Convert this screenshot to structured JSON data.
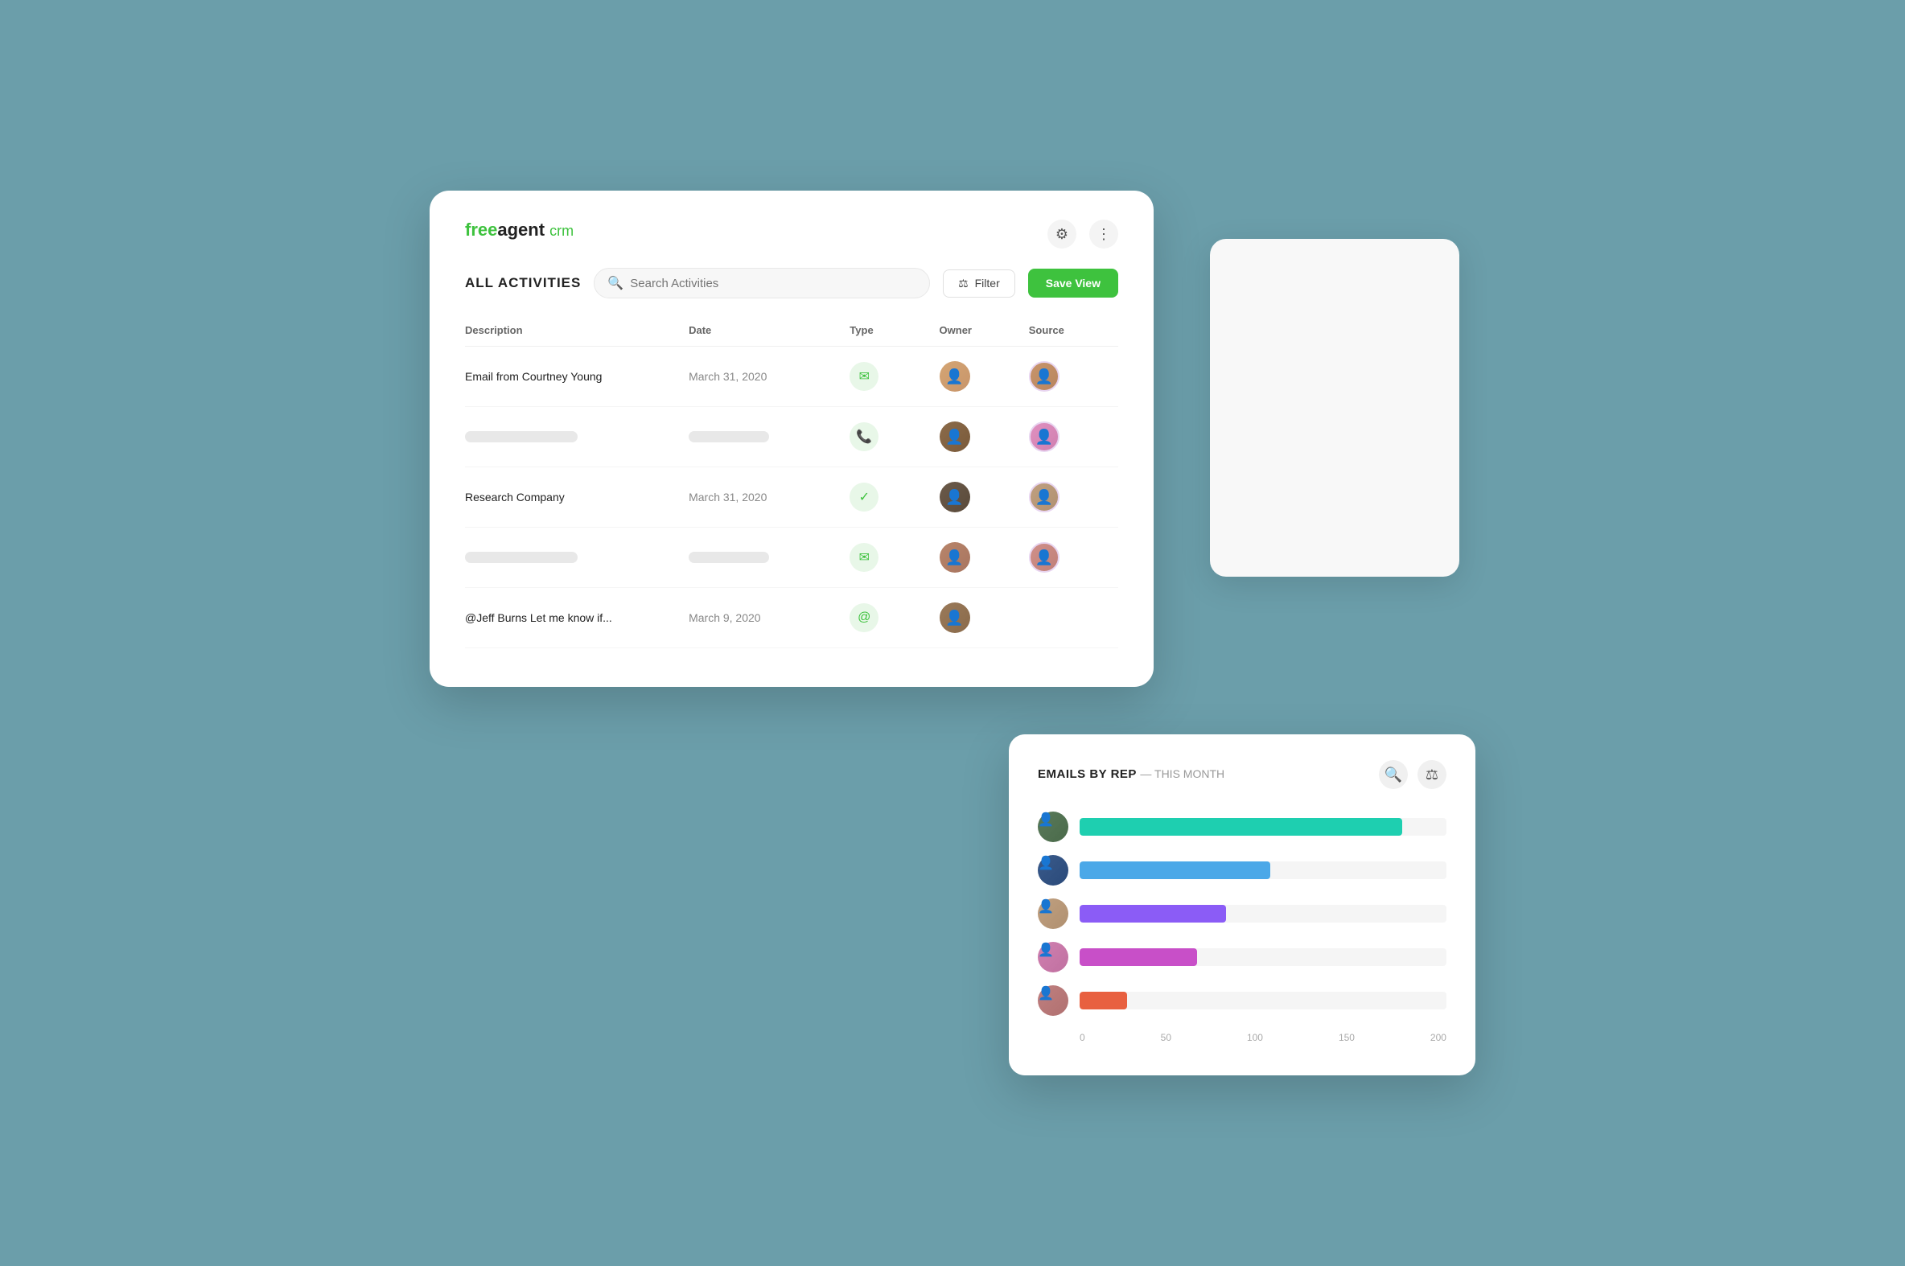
{
  "logo": {
    "free": "free",
    "agent": "agent",
    "crm": "crm"
  },
  "header": {
    "title": "ALL ACTIVITIES",
    "search_placeholder": "Search Activities",
    "filter_label": "Filter",
    "save_view_label": "Save View"
  },
  "table": {
    "columns": [
      "Description",
      "Date",
      "Type",
      "Owner",
      "Source"
    ],
    "rows": [
      {
        "description": "Email from Courtney Young",
        "date": "March 31, 2020",
        "type": "email",
        "type_icon": "✉",
        "owner_avatar": "av-a1",
        "source_avatar": "av-s1",
        "skeleton": false
      },
      {
        "description": "",
        "date": "",
        "type": "phone",
        "type_icon": "✆",
        "owner_avatar": "av-a2",
        "source_avatar": "av-s2",
        "skeleton": true
      },
      {
        "description": "Research Company",
        "date": "March 31, 2020",
        "type": "check",
        "type_icon": "✓",
        "owner_avatar": "av-a3",
        "source_avatar": "av-s3",
        "skeleton": false
      },
      {
        "description": "",
        "date": "",
        "type": "email",
        "type_icon": "✉",
        "owner_avatar": "av-a4",
        "source_avatar": "av-s4",
        "skeleton": true
      },
      {
        "description": "@Jeff Burns Let me know if...",
        "date": "March 9, 2020",
        "type": "at",
        "type_icon": "@",
        "owner_avatar": "av-a5",
        "source_avatar": "",
        "skeleton": false
      }
    ]
  },
  "emails_card": {
    "title": "EMAILS BY REP",
    "period": "— THIS MONTH",
    "bars": [
      {
        "color": "bar-teal",
        "width": "88%",
        "avatar_class": "bar-avatar-1"
      },
      {
        "color": "bar-blue",
        "width": "52%",
        "avatar_class": "bar-avatar-2"
      },
      {
        "color": "bar-purple",
        "width": "40%",
        "avatar_class": "bar-avatar-3"
      },
      {
        "color": "bar-pink",
        "width": "32%",
        "avatar_class": "bar-avatar-4"
      },
      {
        "color": "bar-orange",
        "width": "13%",
        "avatar_class": "bar-avatar-5"
      }
    ],
    "x_axis": [
      "0",
      "50",
      "100",
      "150",
      "200"
    ]
  }
}
